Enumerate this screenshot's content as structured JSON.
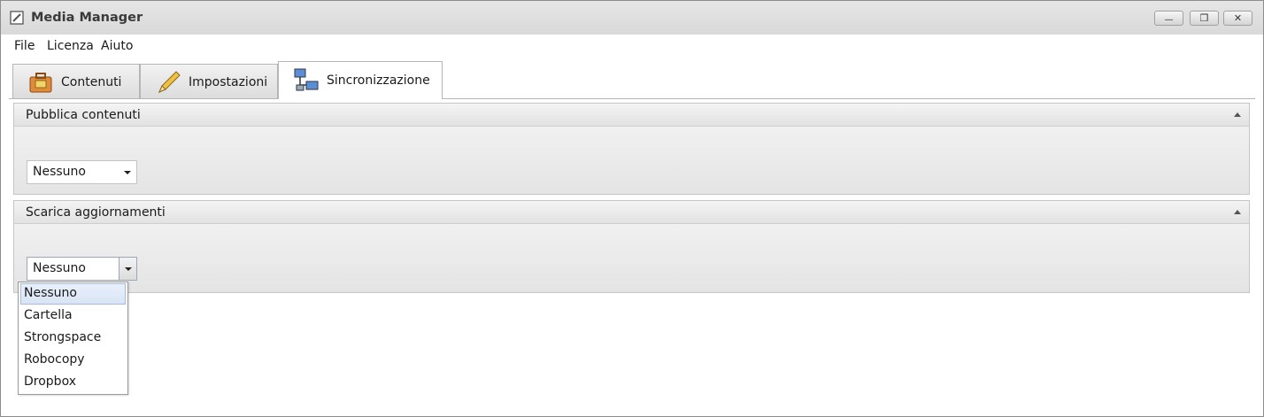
{
  "window": {
    "title": "Media Manager",
    "controls": {
      "minimize": "—",
      "restore": "❐",
      "close": "✕"
    }
  },
  "menu": [
    "File",
    "Licenza",
    "Aiuto"
  ],
  "tabs": [
    {
      "label": "Contenuti",
      "icon": "briefcase-icon",
      "active": false
    },
    {
      "label": "Impostazioni",
      "icon": "pencil-icon",
      "active": false
    },
    {
      "label": "Sincronizzazione",
      "icon": "network-computers-icon",
      "active": true
    }
  ],
  "groups": {
    "publish": {
      "title": "Pubblica contenuti",
      "selected": "Nessuno"
    },
    "download": {
      "title": "Scarica aggiornamenti",
      "selected": "Nessuno"
    }
  },
  "dropdown": {
    "options": [
      "Nessuno",
      "Cartella",
      "Strongspace",
      "Robocopy",
      "Dropbox"
    ],
    "selected_index": 0
  },
  "colors": {
    "selection": "#d8e4f5",
    "border": "#b5b5b5"
  }
}
